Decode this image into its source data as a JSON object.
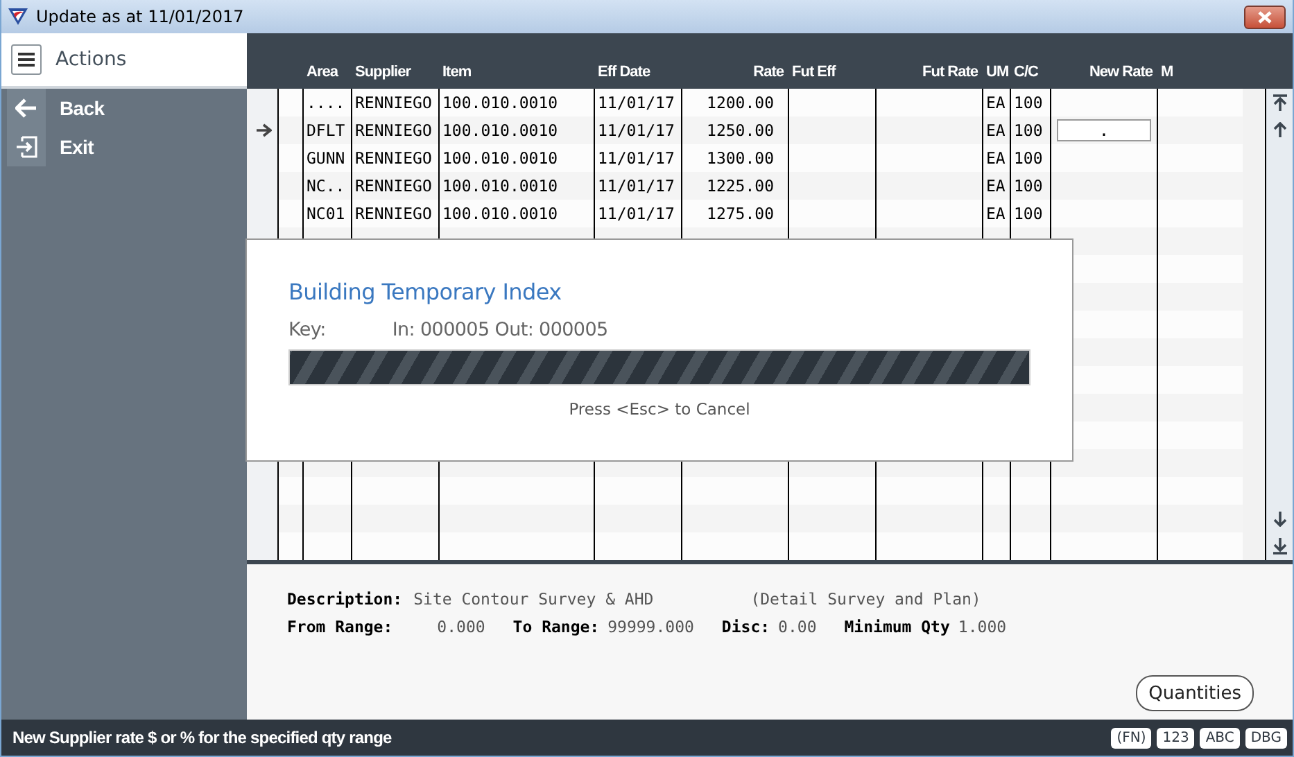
{
  "window": {
    "title": "Update as at 11/01/2017"
  },
  "sidebar": {
    "header": "Actions",
    "items": [
      {
        "label": "Back",
        "kind": "back"
      },
      {
        "label": "Exit",
        "kind": "exit"
      }
    ]
  },
  "grid": {
    "columns": [
      "Area",
      "Supplier",
      "Item",
      "Eff Date",
      "Rate",
      "Fut Eff",
      "Fut Rate",
      "UM",
      "C/C",
      "New Rate",
      "M"
    ],
    "rows": [
      {
        "current": false,
        "area": "....",
        "supplier": "RENNIEGO",
        "item": "100.010.0010",
        "eff_date": "11/01/17",
        "rate": "1200.00",
        "um": "EA",
        "cc": "100"
      },
      {
        "current": true,
        "area": "DFLT",
        "supplier": "RENNIEGO",
        "item": "100.010.0010",
        "eff_date": "11/01/17",
        "rate": "1250.00",
        "um": "EA",
        "cc": "100",
        "new_rate": "."
      },
      {
        "current": false,
        "area": "GUNN",
        "supplier": "RENNIEGO",
        "item": "100.010.0010",
        "eff_date": "11/01/17",
        "rate": "1300.00",
        "um": "EA",
        "cc": "100"
      },
      {
        "current": false,
        "area": "NC..",
        "supplier": "RENNIEGO",
        "item": "100.010.0010",
        "eff_date": "11/01/17",
        "rate": "1225.00",
        "um": "EA",
        "cc": "100"
      },
      {
        "current": false,
        "area": "NC01",
        "supplier": "RENNIEGO",
        "item": "100.010.0010",
        "eff_date": "11/01/17",
        "rate": "1275.00",
        "um": "EA",
        "cc": "100"
      }
    ]
  },
  "dialog": {
    "title": "Building Temporary Index",
    "key_label": "Key:",
    "key_value": "In: 000005 Out: 000005",
    "level": 1,
    "hint": "Press <Esc> to Cancel"
  },
  "detail": {
    "description_label": "Description:",
    "description": "Site Contour Survey & AHD",
    "description_extra": "(Detail Survey and Plan)",
    "fields": [
      {
        "label": "From Range:",
        "value": "0.000"
      },
      {
        "label": "To Range:",
        "value": "99999.000"
      },
      {
        "label": "Disc:",
        "value": "0.00"
      },
      {
        "label": "Minimum Qty",
        "value": "1.000"
      }
    ],
    "button": "Quantities"
  },
  "status_bar": {
    "message": "New Supplier rate $ or % for the specified qty range",
    "badges": [
      "(FN)",
      "123",
      "ABC",
      "DBG"
    ]
  }
}
